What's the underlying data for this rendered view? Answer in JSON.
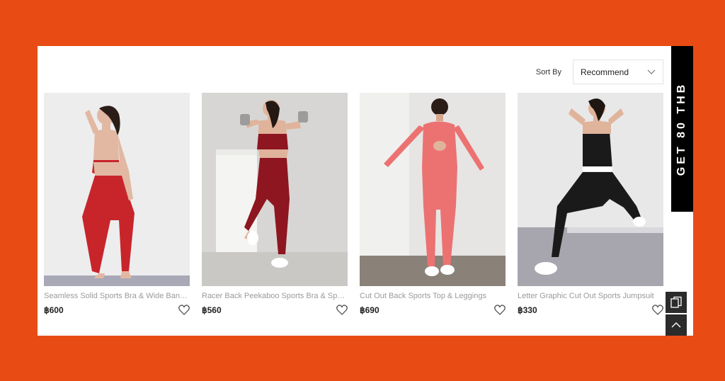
{
  "sort": {
    "label": "Sort By",
    "selected": "Recommend"
  },
  "products": [
    {
      "title": "Seamless Solid Sports Bra & Wide Band ...",
      "price": "฿600",
      "outfit_color": "#c8252b"
    },
    {
      "title": "Racer Back Peekaboo Sports Bra & Sports...",
      "price": "฿560",
      "outfit_color": "#8e1620"
    },
    {
      "title": "Cut Out Back Sports Top & Leggings",
      "price": "฿690",
      "outfit_color": "#ec7272"
    },
    {
      "title": "Letter Graphic Cut Out Sports Jumpsuit",
      "price": "฿330",
      "outfit_color": "#1a1a1a"
    }
  ],
  "promo": {
    "text": "GET 80 THB"
  },
  "colors": {
    "background": "#e84c14",
    "panel": "#ffffff",
    "promo_bg": "#000000"
  }
}
